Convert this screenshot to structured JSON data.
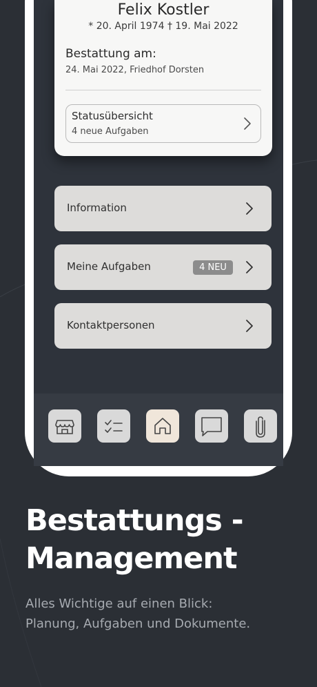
{
  "person": {
    "name": "Felix Kostler",
    "dates": "* 20. April 1974   † 19. Mai 2022"
  },
  "burial": {
    "label": "Bestattung am:",
    "value": "24. Mai 2022, Friedhof Dorsten"
  },
  "status": {
    "title": "Statusübersicht",
    "subtitle": "4 neue Aufgaben"
  },
  "menu": {
    "items": [
      {
        "label": "Information"
      },
      {
        "label": "Meine Aufgaben",
        "badge": "4 NEU"
      },
      {
        "label": "Kontaktpersonen"
      }
    ]
  },
  "tabbar": {
    "tabs": [
      {
        "icon": "store-icon"
      },
      {
        "icon": "checklist-icon"
      },
      {
        "icon": "home-icon",
        "active": true
      },
      {
        "icon": "chat-icon"
      },
      {
        "icon": "paperclip-icon"
      }
    ]
  },
  "marketing": {
    "headline_line1": "Bestattungs -",
    "headline_line2": "Management",
    "sub_line1": "Alles Wichtige auf einen Blick:",
    "sub_line2": "Planung, Aufgaben und  Dokumente."
  },
  "colors": {
    "background": "#2b2f35",
    "screen": "#2e333b",
    "card": "#f7f7f6",
    "button": "#dddcda",
    "active_tab": "#f0e6da",
    "badge": "#8c8c8c"
  }
}
